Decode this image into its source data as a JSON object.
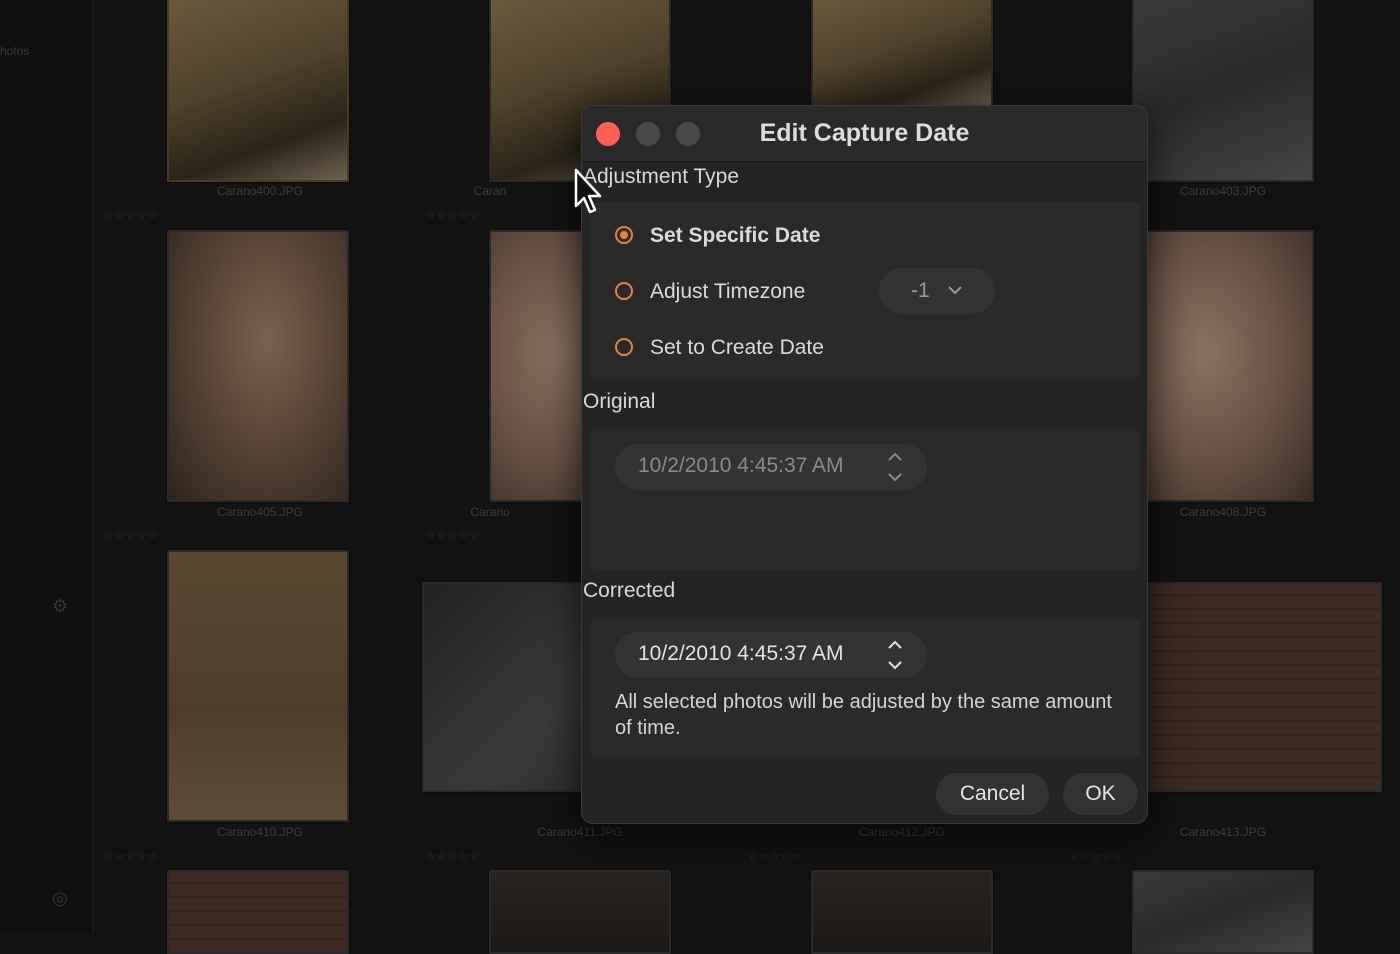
{
  "background": {
    "sidebar_label": "hotos",
    "photos": [
      {
        "name": "Carano400.JPG"
      },
      {
        "name": ""
      },
      {
        "name": ""
      },
      {
        "name": "Carano403.JPG"
      },
      {
        "name": "Carano405.JPG"
      },
      {
        "name": "Carano"
      },
      {
        "name": ""
      },
      {
        "name": "Carano408.JPG"
      },
      {
        "name": "Carano410.JPG"
      },
      {
        "name": "Carano411.JPG"
      },
      {
        "name": "Carano412.JPG"
      },
      {
        "name": "Carano413.JPG"
      }
    ],
    "partial_label_r1": "Caran",
    "stars": "☆☆☆☆☆"
  },
  "dialog": {
    "title": "Edit Capture Date",
    "adjustment_type_label": "Adjustment Type",
    "options": [
      {
        "label": "Set Specific Date",
        "selected": true
      },
      {
        "label": "Adjust Timezone",
        "selected": false
      },
      {
        "label": "Set to Create Date",
        "selected": false
      }
    ],
    "timezone_value": "-1",
    "original_label": "Original",
    "original_value": "10/2/2010 4:45:37 AM",
    "corrected_label": "Corrected",
    "corrected_value": "10/2/2010 4:45:37 AM",
    "note": "All selected photos will be adjusted by the same amount of time.",
    "cancel_label": "Cancel",
    "ok_label": "OK"
  },
  "colors": {
    "accent": "#e8823a",
    "close_button": "#ff5f57",
    "dialog_bg": "#242424"
  },
  "icons": {
    "chevron": "chevron-down-icon",
    "stepper": "stepper-arrows-icon",
    "cursor": "mouse-pointer-icon"
  }
}
